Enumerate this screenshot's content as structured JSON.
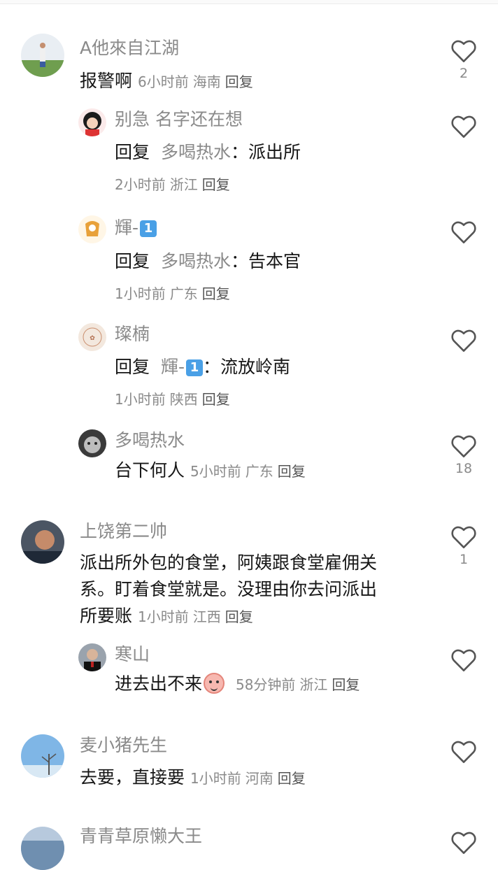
{
  "comments": [
    {
      "user": "A他來自江湖",
      "text": "报警啊",
      "time": "6小时前",
      "location": "海南",
      "reply": "回复",
      "likes": "2"
    },
    {
      "user": "别急 名字还在想",
      "reply_prefix": "回复",
      "reply_to": "多喝热水",
      "text": "派出所",
      "time": "2小时前",
      "location": "浙江",
      "reply": "回复"
    },
    {
      "user": "輝-",
      "reply_prefix": "回复",
      "reply_to": "多喝热水",
      "text": "告本官",
      "time": "1小时前",
      "location": "广东",
      "reply": "回复"
    },
    {
      "user": "璨楠",
      "reply_prefix": "回复",
      "reply_to": "輝-",
      "text": "流放岭南",
      "time": "1小时前",
      "location": "陕西",
      "reply": "回复"
    },
    {
      "user": "多喝热水",
      "text": "台下何人",
      "time": "5小时前",
      "location": "广东",
      "reply": "回复",
      "likes": "18"
    },
    {
      "user": "上饶第二帅",
      "text_line1": "派出所外包的食堂，阿姨跟食堂雇佣关",
      "text_line2": "系。盯着食堂就是。没理由你去问派出",
      "text_line3": "所要账",
      "time": "1小时前",
      "location": "江西",
      "reply": "回复",
      "likes": "1"
    },
    {
      "user": "寒山",
      "text": "进去出不来",
      "time": "58分钟前",
      "location": "浙江",
      "reply": "回复"
    },
    {
      "user": "麦小猪先生",
      "text": "去要，直接要",
      "time": "1小时前",
      "location": "河南",
      "reply": "回复"
    },
    {
      "user": "青青草原懒大王"
    }
  ],
  "badge_num": "1",
  "colors": {
    "meta": "#8a8a8a",
    "text": "#161616",
    "badge": "#4aa0e6"
  },
  "icons": {
    "like": "heart-outline-icon"
  }
}
